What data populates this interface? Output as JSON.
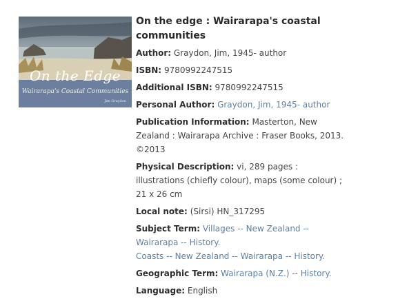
{
  "cover": {
    "title": "On the Edge",
    "subtitle": "Wairarapa's Coastal Communities",
    "author": "Jim Graydon",
    "colors": {
      "sky": "#6f7f8c",
      "sea": "#b9c4c2",
      "sand": "#d9cfb4",
      "band": "#6c7f9e"
    }
  },
  "record": {
    "title": "On the edge : Wairarapa's coastal communities",
    "author": {
      "label": "Author:",
      "value": "Graydon, Jim, 1945- author"
    },
    "isbn": {
      "label": "ISBN:",
      "value": "9780992247515"
    },
    "additional_isbn": {
      "label": "Additional ISBN:",
      "value": "9780992247515"
    },
    "personal_author": {
      "label": "Personal Author:",
      "value": "Graydon, Jim, 1945- author"
    },
    "publication": {
      "label": "Publication Information:",
      "value": "Masterton, New Zealand : Wairarapa Archive : Fraser Books, 2013.",
      "copyright": "©2013"
    },
    "physical": {
      "label": "Physical Description:",
      "value": "vi, 289 pages : illustrations (chiefly colour), maps (some colour) ; 21 x 26 cm"
    },
    "local_note": {
      "label": "Local note:",
      "value": "(Sirsi) HN_317295"
    },
    "subject": {
      "label": "Subject Term:",
      "terms": [
        "Villages -- New Zealand -- Wairarapa -- History.",
        "Coasts -- New Zealand -- Wairarapa -- History."
      ]
    },
    "geographic": {
      "label": "Geographic Term:",
      "value": "Wairarapa (N.Z.) -- History."
    },
    "language": {
      "label": "Language:",
      "value": "English"
    }
  }
}
